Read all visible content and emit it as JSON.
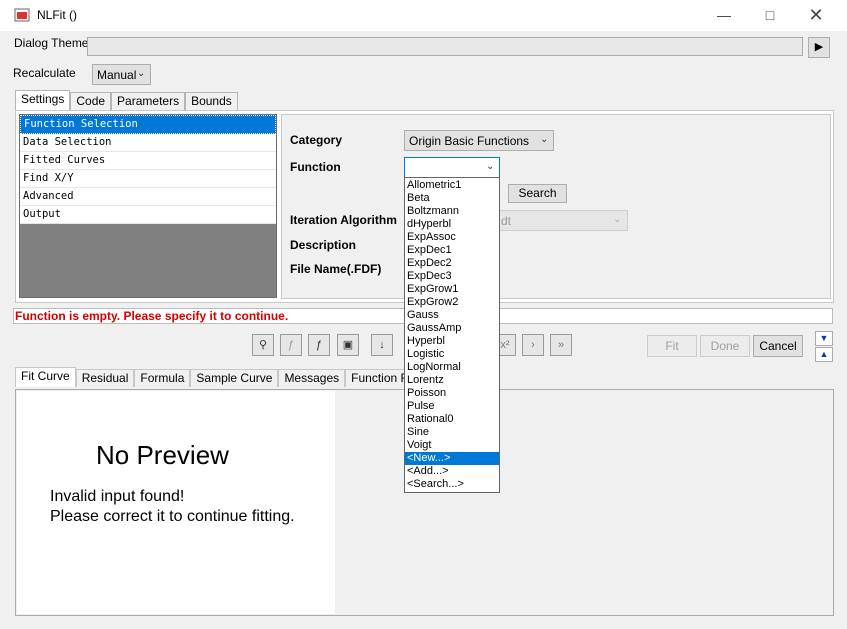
{
  "window": {
    "title": "NLFit ()",
    "minimize_icon": "minimize-icon",
    "maximize_icon": "maximize-icon",
    "close_icon": "close-icon"
  },
  "dialog_theme": {
    "label": "Dialog Theme",
    "arrow_icon": "arrow-right-icon"
  },
  "recalculate": {
    "label": "Recalculate",
    "value": "Manual"
  },
  "tabs": [
    {
      "label": "Settings"
    },
    {
      "label": "Code"
    },
    {
      "label": "Parameters"
    },
    {
      "label": "Bounds"
    }
  ],
  "tree_items": [
    {
      "label": "Function Selection"
    },
    {
      "label": "Data Selection"
    },
    {
      "label": "Fitted Curves"
    },
    {
      "label": "Find X/Y"
    },
    {
      "label": "Advanced"
    },
    {
      "label": "Output"
    }
  ],
  "settings": {
    "category_label": "Category",
    "category_value": "Origin Basic Functions",
    "function_label": "Function",
    "function_value": "",
    "search_button": "Search",
    "iteration_label": "Iteration Algorithm",
    "iteration_value_partial": "dt",
    "description_label": "Description",
    "file_name_label": "File Name(.FDF)"
  },
  "function_options": [
    {
      "label": "Allometric1"
    },
    {
      "label": "Beta"
    },
    {
      "label": "Boltzmann"
    },
    {
      "label": "dHyperbl"
    },
    {
      "label": "ExpAssoc"
    },
    {
      "label": "ExpDec1"
    },
    {
      "label": "ExpDec2"
    },
    {
      "label": "ExpDec3"
    },
    {
      "label": "ExpGrow1"
    },
    {
      "label": "ExpGrow2"
    },
    {
      "label": "Gauss"
    },
    {
      "label": "GaussAmp"
    },
    {
      "label": "Hyperbl"
    },
    {
      "label": "Logistic"
    },
    {
      "label": "LogNormal"
    },
    {
      "label": "Lorentz"
    },
    {
      "label": "Poisson"
    },
    {
      "label": "Pulse"
    },
    {
      "label": "Rational0"
    },
    {
      "label": "Sine"
    },
    {
      "label": "Voigt"
    },
    {
      "label": "<New...>"
    },
    {
      "label": "<Add...>"
    },
    {
      "label": "<Search...>"
    }
  ],
  "selected_option": "<New...>",
  "status": {
    "message": "Function is empty. Please specify it to continue.",
    "color": "#d40000"
  },
  "toolbar": {
    "icons": [
      "find-function-icon",
      "reference-icon",
      "fx-file-icon",
      "save-icon",
      "sort-icon"
    ],
    "right_icons": [
      "x2-icon",
      "step-icon",
      "step-end-icon"
    ],
    "fit_label": "Fit",
    "done_label": "Done",
    "cancel_label": "Cancel"
  },
  "content_tabs": [
    {
      "label": "Fit Curve"
    },
    {
      "label": "Residual"
    },
    {
      "label": "Formula"
    },
    {
      "label": "Sample Curve"
    },
    {
      "label": "Messages"
    },
    {
      "label": "Function File"
    }
  ],
  "preview": {
    "heading": "No Preview",
    "line1": "Invalid input found!",
    "line2": "Please correct it to continue fitting."
  },
  "colors": {
    "selection": "#0078d7",
    "gray_panel": "#808080",
    "error": "#d40000"
  }
}
